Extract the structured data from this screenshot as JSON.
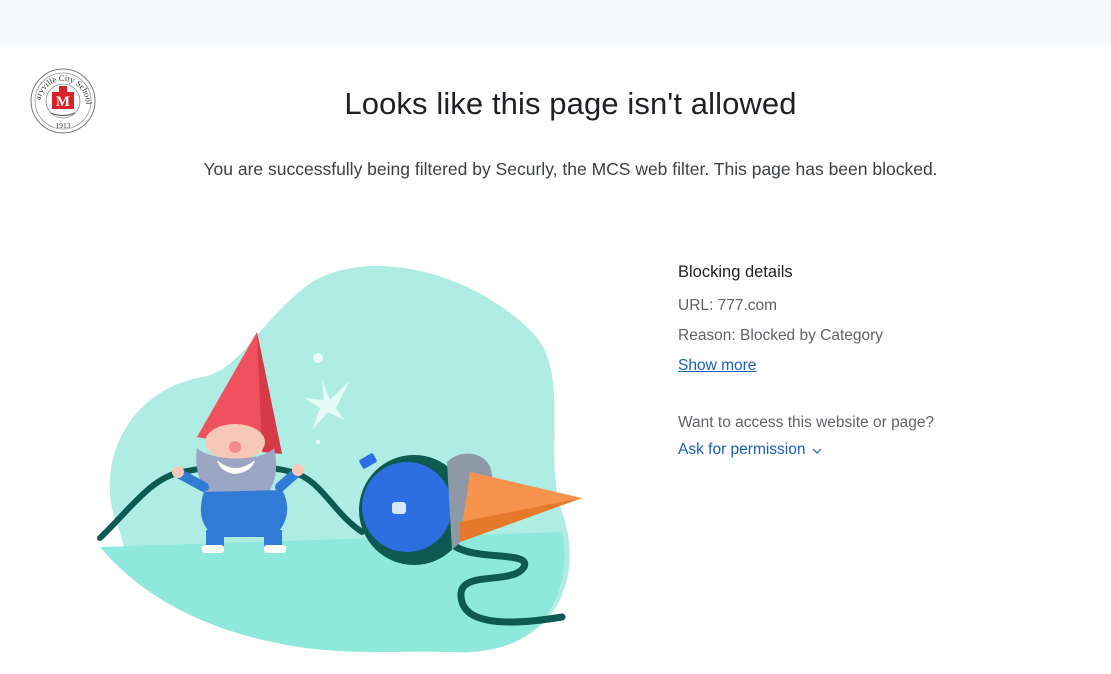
{
  "header": {
    "logo": {
      "text_top": "Maryville City Schools",
      "letter": "M",
      "year": "1913",
      "icon": "school-seal-icon"
    }
  },
  "main": {
    "title": "Looks like this page isn't allowed",
    "subtitle": "You are successfully being filtered by Securly, the MCS web filter. This page has been blocked."
  },
  "details": {
    "heading": "Blocking details",
    "url_line": "URL: 777.com",
    "reason_line": "Reason: Blocked by Category",
    "show_more": "Show more",
    "access_question": "Want to access this website or page?",
    "ask_permission": "Ask for permission",
    "ask_icon": "chevron-down-icon"
  },
  "illustration": {
    "icon": "gnome-cutting-cable-illustration"
  },
  "colors": {
    "link": "#1a5fb4",
    "blob": "#aeece4",
    "ground": "#8ee8db",
    "cable": "#0e5a52",
    "hat": "#f0505e",
    "gnome_suit": "#2f7bd6",
    "plug": "#2d6fe0",
    "cone": "#f7934c"
  }
}
